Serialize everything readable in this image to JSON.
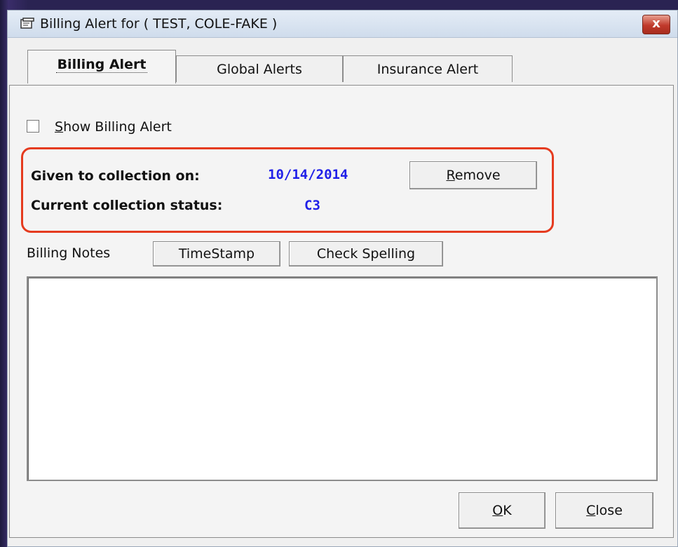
{
  "window": {
    "title": "Billing Alert for ( TEST, COLE-FAKE )",
    "close_glyph": "x"
  },
  "tabs": [
    {
      "label": "Billing Alert",
      "active": true
    },
    {
      "label": "Global Alerts",
      "active": false
    },
    {
      "label": "Insurance Alert",
      "active": false
    }
  ],
  "billing_alert": {
    "show_checkbox": {
      "label_first": "S",
      "label_rest": "how Billing Alert",
      "checked": false
    },
    "collection": {
      "given_label": "Given to collection on:",
      "given_date": "10/14/2014",
      "remove_first": "R",
      "remove_rest": "emove",
      "status_label": "Current collection status:",
      "status_value": "C3"
    },
    "notes": {
      "label": "Billing Notes",
      "timestamp_button": "TimeStamp",
      "spelling_button": "Check Spelling",
      "text": ""
    }
  },
  "footer": {
    "ok_first": "O",
    "ok_rest": "K",
    "close_first": "C",
    "close_rest": "lose"
  },
  "colors": {
    "highlight_border": "#e53b1f",
    "value_text": "#2020e8",
    "close_button": "#c0392b"
  }
}
